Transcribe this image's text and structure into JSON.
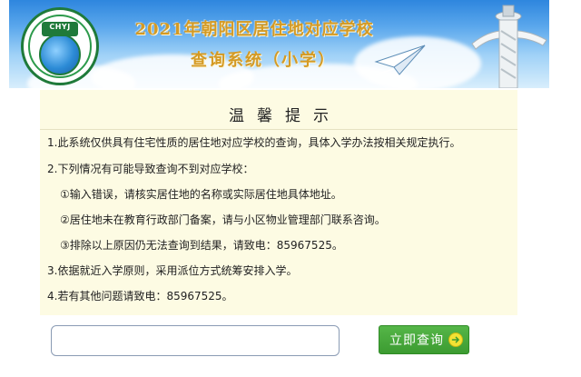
{
  "banner": {
    "title_line1": "2021年朝阳区居住地对应学校",
    "title_line2": "查询系统（小学）",
    "logo_icon": "school-globe-logo",
    "plane_icon": "paper-plane-icon",
    "pillar_icon": "huabiao-pillar-icon",
    "colors": {
      "sky": "#2e86de",
      "title": "#d49a24"
    }
  },
  "notice": {
    "heading": "温馨提示",
    "lines": [
      "1.此系统仅供具有住宅性质的居住地对应学校的查询，具体入学办法按相关规定执行。",
      "2.下列情况有可能导致查询不到对应学校：",
      "①输入错误，请核实居住地的名称或实际居住地具体地址。",
      "②居住地未在教育行政部门备案，请与小区物业管理部门联系咨询。",
      "③排除以上原因仍无法查询到结果，请致电：85967525。",
      "3.依据就近入学原则，采用派位方式统筹安排入学。",
      "4.若有其他问题请致电：85967525。"
    ],
    "background": "#fdfbe3"
  },
  "search": {
    "value": "",
    "placeholder": "",
    "button_label": "立即查询",
    "button_icon": "arrow-circle-right-icon",
    "button_color": "#4aa93e"
  }
}
